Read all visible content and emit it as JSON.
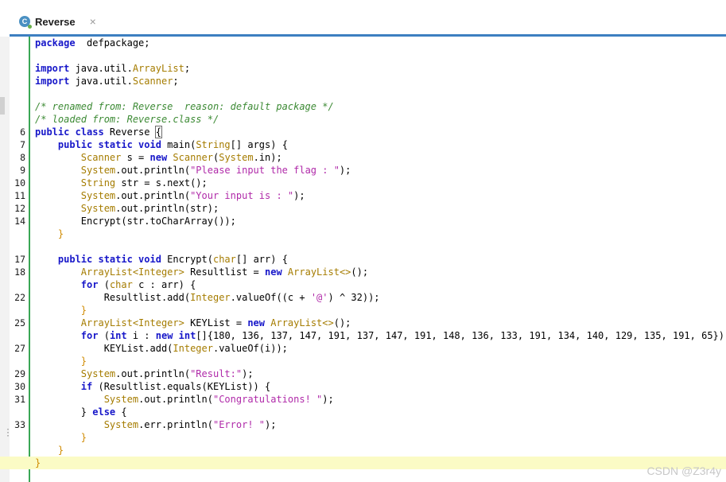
{
  "tab": {
    "title": "Reverse",
    "icon": "class-file-icon",
    "close": "×",
    "icon_letter": "C"
  },
  "watermark": "CSDN @Z3r4y",
  "editor": {
    "lines": [
      {
        "n": "",
        "tokens": [
          [
            "kw",
            "package"
          ],
          [
            "",
            "  defpackage;"
          ]
        ]
      },
      {
        "n": "",
        "tokens": []
      },
      {
        "n": "",
        "tokens": [
          [
            "kw",
            "import"
          ],
          [
            "",
            " java.util."
          ],
          [
            "ty",
            "ArrayList"
          ],
          [
            "",
            ";"
          ]
        ]
      },
      {
        "n": "",
        "tokens": [
          [
            "kw",
            "import"
          ],
          [
            "",
            " java.util."
          ],
          [
            "ty",
            "Scanner"
          ],
          [
            "",
            ";"
          ]
        ]
      },
      {
        "n": "",
        "tokens": []
      },
      {
        "n": "",
        "tokens": [
          [
            "cm",
            "/* renamed from: Reverse  reason: default package */"
          ]
        ]
      },
      {
        "n": "",
        "tokens": [
          [
            "cm",
            "/* loaded from: Reverse.class */"
          ]
        ]
      },
      {
        "n": "6",
        "tokens": [
          [
            "kw",
            "public class"
          ],
          [
            "",
            " Reverse "
          ],
          [
            "brace",
            "{"
          ]
        ]
      },
      {
        "n": "7",
        "tokens": [
          [
            "",
            "    "
          ],
          [
            "kw",
            "public static void"
          ],
          [
            "",
            " main("
          ],
          [
            "ty",
            "String"
          ],
          [
            "",
            "[] args) {"
          ]
        ]
      },
      {
        "n": "8",
        "tokens": [
          [
            "",
            "        "
          ],
          [
            "ty",
            "Scanner"
          ],
          [
            "",
            " s = "
          ],
          [
            "kw",
            "new"
          ],
          [
            "",
            " "
          ],
          [
            "ty",
            "Scanner"
          ],
          [
            "",
            "("
          ],
          [
            "ty",
            "System"
          ],
          [
            "",
            ".in);"
          ]
        ]
      },
      {
        "n": "9",
        "tokens": [
          [
            "",
            "        "
          ],
          [
            "ty",
            "System"
          ],
          [
            "",
            ".out.println("
          ],
          [
            "st",
            "\"Please input the flag : \""
          ],
          [
            "",
            ");"
          ]
        ]
      },
      {
        "n": "10",
        "tokens": [
          [
            "",
            "        "
          ],
          [
            "ty",
            "String"
          ],
          [
            "",
            " str = s.next();"
          ]
        ]
      },
      {
        "n": "11",
        "tokens": [
          [
            "",
            "        "
          ],
          [
            "ty",
            "System"
          ],
          [
            "",
            ".out.println("
          ],
          [
            "st",
            "\"Your input is : \""
          ],
          [
            "",
            ");"
          ]
        ]
      },
      {
        "n": "12",
        "tokens": [
          [
            "",
            "        "
          ],
          [
            "ty",
            "System"
          ],
          [
            "",
            ".out.println(str);"
          ]
        ]
      },
      {
        "n": "14",
        "tokens": [
          [
            "",
            "        Encrypt(str.toCharArray());"
          ]
        ]
      },
      {
        "n": "",
        "tokens": [
          [
            "",
            "    "
          ],
          [
            "hb",
            "}"
          ]
        ]
      },
      {
        "n": "",
        "tokens": []
      },
      {
        "n": "17",
        "tokens": [
          [
            "",
            "    "
          ],
          [
            "kw",
            "public static void"
          ],
          [
            "",
            " Encrypt("
          ],
          [
            "ty",
            "char"
          ],
          [
            "",
            "[] arr) {"
          ]
        ]
      },
      {
        "n": "18",
        "tokens": [
          [
            "",
            "        "
          ],
          [
            "ty",
            "ArrayList<Integer>"
          ],
          [
            "",
            " Resultlist = "
          ],
          [
            "kw",
            "new"
          ],
          [
            "",
            " "
          ],
          [
            "ty",
            "ArrayList<>"
          ],
          [
            "",
            "();"
          ]
        ]
      },
      {
        "n": "",
        "tokens": [
          [
            "",
            "        "
          ],
          [
            "kw",
            "for"
          ],
          [
            "",
            " ("
          ],
          [
            "ty",
            "char"
          ],
          [
            "",
            " c : arr) {"
          ]
        ]
      },
      {
        "n": "22",
        "tokens": [
          [
            "",
            "            Resultlist.add("
          ],
          [
            "ty",
            "Integer"
          ],
          [
            "",
            ".valueOf((c + "
          ],
          [
            "st",
            "'@'"
          ],
          [
            "",
            ") ^ 32));"
          ]
        ]
      },
      {
        "n": "",
        "tokens": [
          [
            "",
            "        "
          ],
          [
            "hb",
            "}"
          ]
        ]
      },
      {
        "n": "25",
        "tokens": [
          [
            "",
            "        "
          ],
          [
            "ty",
            "ArrayList<Integer>"
          ],
          [
            "",
            " KEYList = "
          ],
          [
            "kw",
            "new"
          ],
          [
            "",
            " "
          ],
          [
            "ty",
            "ArrayList<>"
          ],
          [
            "",
            "();"
          ]
        ]
      },
      {
        "n": "",
        "tokens": [
          [
            "",
            "        "
          ],
          [
            "kw",
            "for"
          ],
          [
            "",
            " ("
          ],
          [
            "kw",
            "int"
          ],
          [
            "",
            " i : "
          ],
          [
            "kw",
            "new int"
          ],
          [
            "",
            "[]{180, 136, 137, 147, 191, 137, 147, 191, 148, 136, 133, 191, 134, 140, 129, 135, 191, 65}) {"
          ]
        ]
      },
      {
        "n": "27",
        "tokens": [
          [
            "",
            "            KEYList.add("
          ],
          [
            "ty",
            "Integer"
          ],
          [
            "",
            ".valueOf(i));"
          ]
        ]
      },
      {
        "n": "",
        "tokens": [
          [
            "",
            "        "
          ],
          [
            "hb",
            "}"
          ]
        ]
      },
      {
        "n": "29",
        "tokens": [
          [
            "",
            "        "
          ],
          [
            "ty",
            "System"
          ],
          [
            "",
            ".out.println("
          ],
          [
            "st",
            "\"Result:\""
          ],
          [
            "",
            ");"
          ]
        ]
      },
      {
        "n": "30",
        "tokens": [
          [
            "",
            "        "
          ],
          [
            "kw",
            "if"
          ],
          [
            "",
            " (Resultlist.equals(KEYList)) {"
          ]
        ]
      },
      {
        "n": "31",
        "tokens": [
          [
            "",
            "            "
          ],
          [
            "ty",
            "System"
          ],
          [
            "",
            ".out.println("
          ],
          [
            "st",
            "\"Congratulations! \""
          ],
          [
            "",
            ");"
          ]
        ]
      },
      {
        "n": "",
        "tokens": [
          [
            "",
            "        } "
          ],
          [
            "kw",
            "else"
          ],
          [
            "",
            " {"
          ]
        ]
      },
      {
        "n": "33",
        "tokens": [
          [
            "",
            "            "
          ],
          [
            "ty",
            "System"
          ],
          [
            "",
            ".err.println("
          ],
          [
            "st",
            "\"Error! \""
          ],
          [
            "",
            ");"
          ]
        ]
      },
      {
        "n": "",
        "tokens": [
          [
            "",
            "        "
          ],
          [
            "hb",
            "}"
          ]
        ]
      },
      {
        "n": "",
        "tokens": [
          [
            "",
            "    "
          ],
          [
            "hb",
            "}"
          ]
        ]
      },
      {
        "n": "",
        "tokens": [
          [
            "hb",
            "}"
          ]
        ],
        "highlight": true
      }
    ]
  }
}
